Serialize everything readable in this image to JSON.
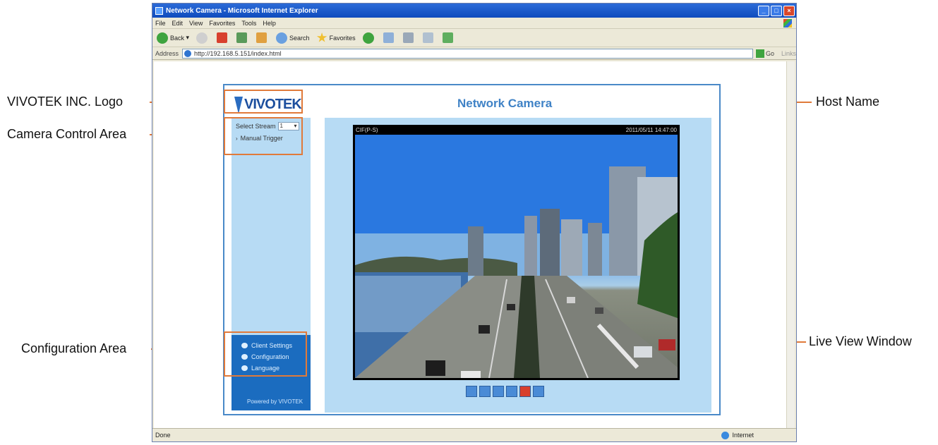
{
  "annotations": {
    "logo": "VIVOTEK INC. Logo",
    "camera_control": "Camera Control Area",
    "configuration": "Configuration Area",
    "host_name": "Host Name",
    "live_view": "Live View Window"
  },
  "browser": {
    "title": "Network Camera - Microsoft Internet Explorer",
    "menu": [
      "File",
      "Edit",
      "View",
      "Favorites",
      "Tools",
      "Help"
    ],
    "toolbar": {
      "back": "Back",
      "search": "Search",
      "favorites": "Favorites"
    },
    "address_label": "Address",
    "address": "http://192.168.5.151/index.html",
    "go": "Go",
    "links": "Links",
    "status_left": "Done",
    "status_zone": "Internet"
  },
  "page": {
    "logo_text": "VIVOTEK",
    "host_name": "Network Camera",
    "select_stream_label": "Select Stream",
    "select_stream_value": "1",
    "manual_trigger": "Manual Trigger",
    "config_items": [
      "Client Settings",
      "Configuration",
      "Language"
    ],
    "powered_by": "Powered by VIVOTEK",
    "video_left": "CIF(P-S)",
    "video_right": "2011/05/11 14:47:00"
  },
  "colors": {
    "accent": "#e07a3a",
    "brand": "#1d4f9e",
    "panel": "#b7dbf4",
    "config_bg": "#1b6cbf"
  },
  "icons": [
    "back-icon",
    "forward-icon",
    "stop-icon",
    "refresh-icon",
    "home-icon",
    "search-icon",
    "favorites-icon",
    "history-icon",
    "mail-icon",
    "print-icon",
    "edit-icon",
    "messenger-icon",
    "snapshot-icon",
    "zoom-icon",
    "pause-icon",
    "stop-video-icon",
    "record-icon",
    "fullscreen-icon"
  ]
}
